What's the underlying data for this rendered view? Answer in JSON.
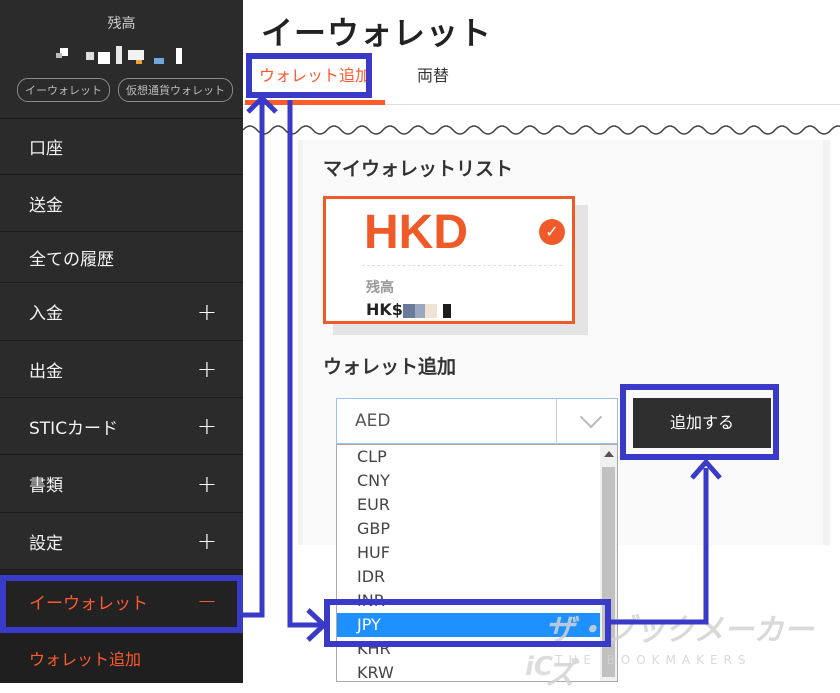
{
  "sidebar": {
    "balance_label": "残高",
    "pills": [
      "イーウォレット",
      "仮想通貨ウォレット"
    ],
    "menu": [
      {
        "label": "口座",
        "expand": ""
      },
      {
        "label": "送金",
        "expand": ""
      },
      {
        "label": "全ての履歴",
        "expand": ""
      },
      {
        "label": "入金",
        "expand": "+"
      },
      {
        "label": "出金",
        "expand": "+"
      },
      {
        "label": "STICカード",
        "expand": "+"
      },
      {
        "label": "書類",
        "expand": "+"
      },
      {
        "label": "設定",
        "expand": "+"
      },
      {
        "label": "イーウォレット",
        "expand": "−"
      }
    ],
    "submenu": [
      "ウォレット追加"
    ]
  },
  "main": {
    "title": "イーウォレット",
    "tabs": [
      "ウォレット追加",
      "両替"
    ],
    "my_wallet_title": "マイウォレットリスト",
    "card": {
      "currency": "HKD",
      "balance_label": "残高",
      "balance_prefix": "HK$",
      "check": "✓"
    },
    "add_wallet_title": "ウォレット追加",
    "select_value": "AED",
    "options": [
      "CLP",
      "CNY",
      "EUR",
      "GBP",
      "HUF",
      "IDR",
      "INR",
      "JPY",
      "KHR",
      "KRW"
    ],
    "selected_option": "JPY",
    "add_button": "追加する"
  },
  "watermark": {
    "text": "ザ・ブックメーカーズ",
    "sub": "THE BOOKMAKERS"
  },
  "colors": {
    "accent": "#f05a28",
    "annotation": "#3a3ac8",
    "sidebar": "#2b2b2b",
    "select_highlight": "#1e90ff"
  }
}
